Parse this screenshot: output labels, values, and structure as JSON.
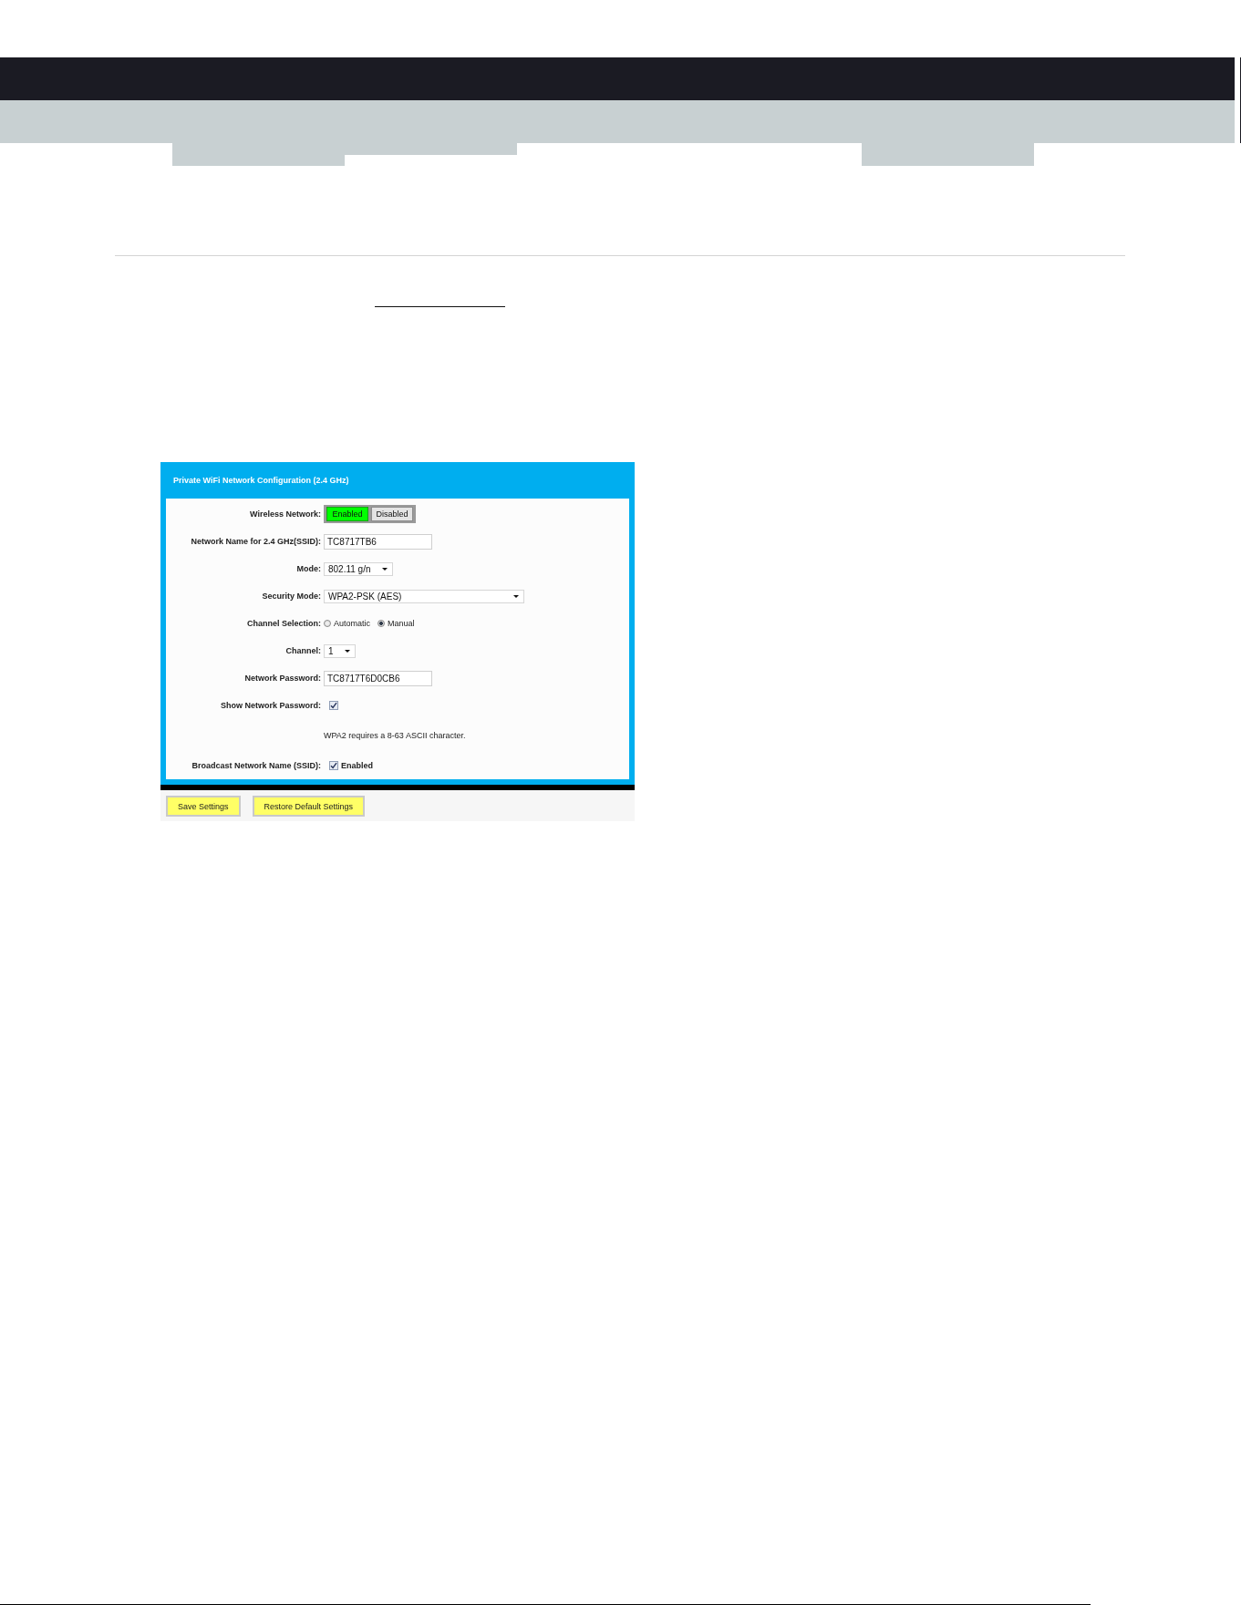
{
  "panel": {
    "title": "Private WiFi Network Configuration (2.4 GHz)",
    "fields": [
      {
        "kind": "toggle",
        "label": "Wireless Network:",
        "options": [
          {
            "label": "Enabled",
            "selected": true
          },
          {
            "label": "Disabled",
            "selected": false
          }
        ]
      },
      {
        "kind": "text",
        "label": "Network Name for 2.4 GHz(SSID):",
        "value": "TC8717TB6"
      },
      {
        "kind": "select",
        "label": "Mode:",
        "value": "802.11 g/n"
      },
      {
        "kind": "select",
        "label": "Security Mode:",
        "value": "WPA2-PSK (AES)"
      },
      {
        "kind": "radio",
        "label": "Channel Selection:",
        "options": [
          {
            "label": "Automatic",
            "selected": false
          },
          {
            "label": "Manual",
            "selected": true
          }
        ]
      },
      {
        "kind": "select",
        "label": "Channel:",
        "value": "1"
      },
      {
        "kind": "text",
        "label": "Network Password:",
        "value": "TC8717T6D0CB6"
      },
      {
        "kind": "checkbox",
        "label": "Show Network Password:",
        "checked": true
      },
      {
        "kind": "note",
        "text": "WPA2 requires a 8-63 ASCII character."
      },
      {
        "kind": "checkbox",
        "label": "Broadcast Network Name (SSID):",
        "checked": true,
        "caption": "Enabled"
      }
    ]
  },
  "buttons": [
    "Save Settings",
    "Restore Default Settings"
  ]
}
